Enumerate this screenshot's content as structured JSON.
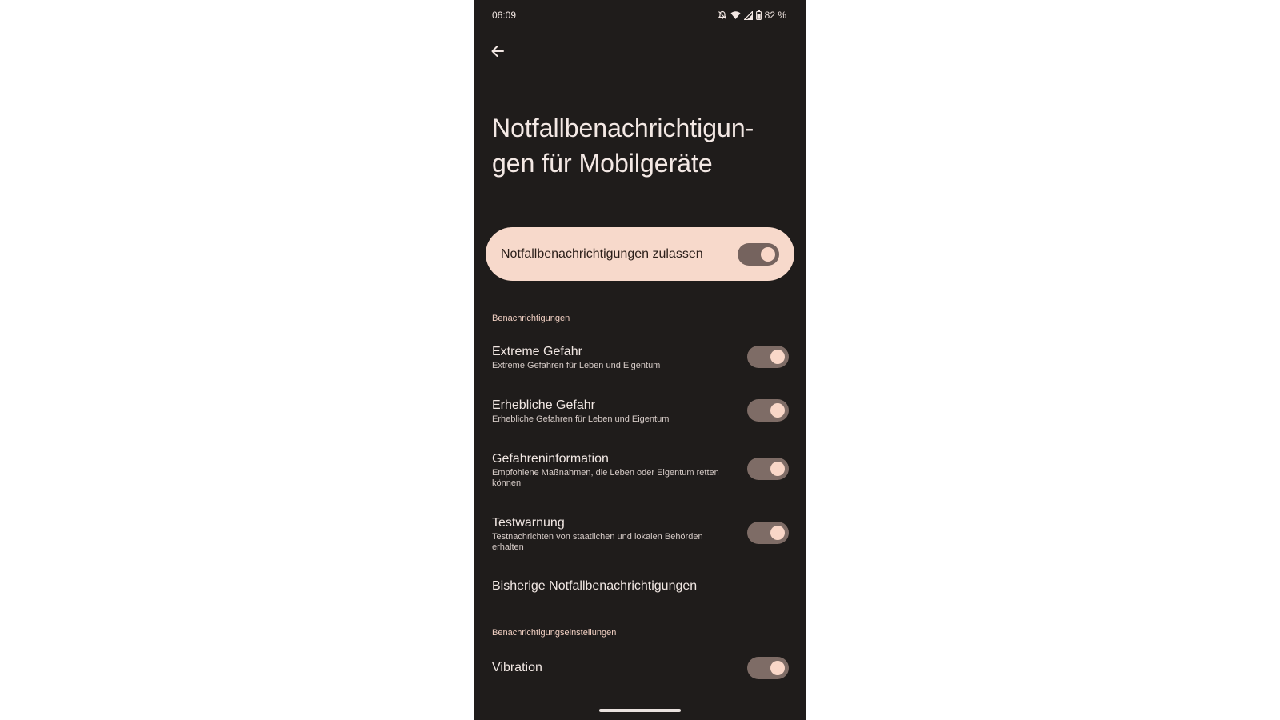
{
  "status_bar": {
    "time": "06:09",
    "battery": "82 %",
    "icons": [
      "bell-off-icon",
      "wifi-icon",
      "signal-icon",
      "battery-icon"
    ]
  },
  "header": {
    "back_icon": "arrow-left-icon",
    "title_line1": "Notfallbenachrichtigun-",
    "title_line2": "gen für Mobilgeräte"
  },
  "master": {
    "label": "Notfallbenachrichtigungen zulassen",
    "enabled": true
  },
  "sections": {
    "notifications_header": "Benachrichtigungen",
    "settings_header": "Benachrichtigungseinstellungen"
  },
  "items": [
    {
      "title": "Extreme Gefahr",
      "subtitle": "Extreme Gefahren für Leben und Eigentum",
      "enabled": true
    },
    {
      "title": "Erhebliche Gefahr",
      "subtitle": "Erhebliche Gefahren für Leben und Eigentum",
      "enabled": true
    },
    {
      "title": "Gefahreninformation",
      "subtitle": "Empfohlene Maßnahmen, die Leben oder Eigentum retten können",
      "enabled": true
    },
    {
      "title": "Testwarnung",
      "subtitle": "Testnachrichten von staatlichen und lokalen Behörden erhalten",
      "enabled": true
    }
  ],
  "history": {
    "label": "Bisherige Notfallbenachrichtigungen"
  },
  "vibration": {
    "label": "Vibration",
    "enabled": true
  },
  "colors": {
    "background": "#1f1c1b",
    "card": "#f7d9cb",
    "switch_track": "#7e6c66",
    "switch_knob": "#f9d7c8",
    "section_header": "#f0cfc2"
  }
}
